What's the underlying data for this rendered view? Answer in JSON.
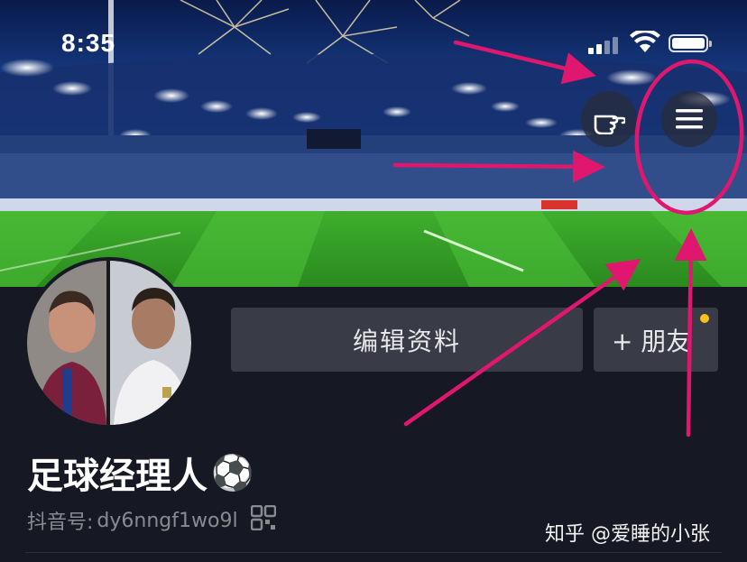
{
  "status_bar": {
    "time": "8:35"
  },
  "header": {
    "gesture_button": {
      "icon": "hand-pointer-icon"
    },
    "menu_button": {
      "icon": "hamburger-menu-icon"
    }
  },
  "profile": {
    "edit_button_label": "编辑资料",
    "add_friend_label": "+ 朋友",
    "nickname": "足球经理人",
    "nickname_emoji": "⚽",
    "douyin_id_label": "抖音号:",
    "douyin_id": "dy6nngf1wo9l"
  },
  "watermark": "知乎 @爱睡的小张",
  "colors": {
    "background": "#161823",
    "button_bg": "#393b46",
    "annotation": "#e0176e",
    "notification_dot": "#f7c21b"
  }
}
